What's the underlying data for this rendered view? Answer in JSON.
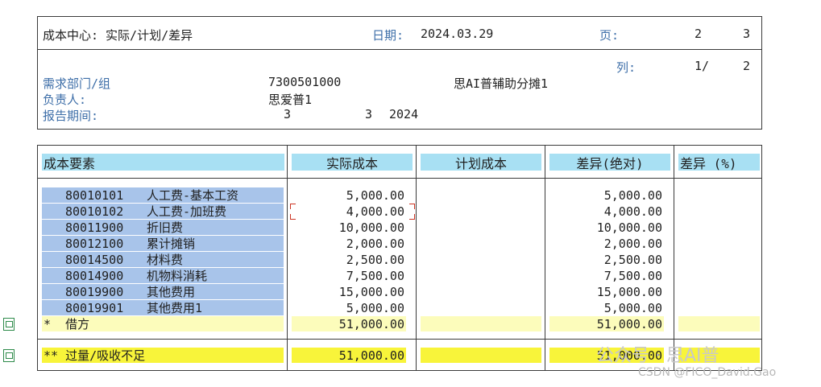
{
  "header": {
    "cost_center_label": "成本中心: 实际/计划/差异",
    "date_label": "日期:",
    "date_value": "2024.03.29",
    "page_label": "页:",
    "page_current": "2",
    "page_total": "3",
    "column_label": "列:",
    "column_value": "1/",
    "column_total": "2",
    "dept_label": "需求部门/组",
    "dept_code": "7300501000",
    "dept_name": "思AI普辅助分摊1",
    "owner_label": "负责人:",
    "owner_value": "思爱普1",
    "period_label": "报告期间:",
    "period_from": "3",
    "period_to": "3",
    "period_year": "2024"
  },
  "table": {
    "columns": [
      "成本要素",
      "实际成本",
      "计划成本",
      "差异(绝对)",
      "差异 (%)"
    ],
    "rows": [
      {
        "code": "80010101",
        "name": "人工费-基本工资",
        "actual": "5,000.00",
        "plan": "",
        "diff": "5,000.00",
        "pct": ""
      },
      {
        "code": "80010102",
        "name": "人工费-加班费",
        "actual": "4,000.00",
        "plan": "",
        "diff": "4,000.00",
        "pct": ""
      },
      {
        "code": "80011900",
        "name": "折旧费",
        "actual": "10,000.00",
        "plan": "",
        "diff": "10,000.00",
        "pct": ""
      },
      {
        "code": "80012100",
        "name": "累计摊销",
        "actual": "2,000.00",
        "plan": "",
        "diff": "2,000.00",
        "pct": ""
      },
      {
        "code": "80014500",
        "name": "材料费",
        "actual": "2,500.00",
        "plan": "",
        "diff": "2,500.00",
        "pct": ""
      },
      {
        "code": "80014900",
        "name": "机物料消耗",
        "actual": "7,500.00",
        "plan": "",
        "diff": "7,500.00",
        "pct": ""
      },
      {
        "code": "80019900",
        "name": "其他费用",
        "actual": "15,000.00",
        "plan": "",
        "diff": "15,000.00",
        "pct": ""
      },
      {
        "code": "80019901",
        "name": "其他费用1",
        "actual": "5,000.00",
        "plan": "",
        "diff": "5,000.00",
        "pct": ""
      }
    ],
    "subtotal": {
      "label": "*  借方",
      "actual": "51,000.00",
      "diff": "51,000.00"
    },
    "total": {
      "label": "** 过量/吸收不足",
      "actual": "51,000.00",
      "diff": "51,000.00"
    }
  },
  "watermark": {
    "line1": "公众号 · 思AI普",
    "line2": "CSDN @FICO_David.Gao"
  },
  "icons": [
    "document-icon",
    "document-icon"
  ],
  "colors": {
    "header_cell": "#a8e0f3",
    "key_cell": "#a8c4ea",
    "subtotal_row": "#fcfcbb",
    "total_row": "#f8f43a",
    "label_blue": "#3d6ea8"
  }
}
